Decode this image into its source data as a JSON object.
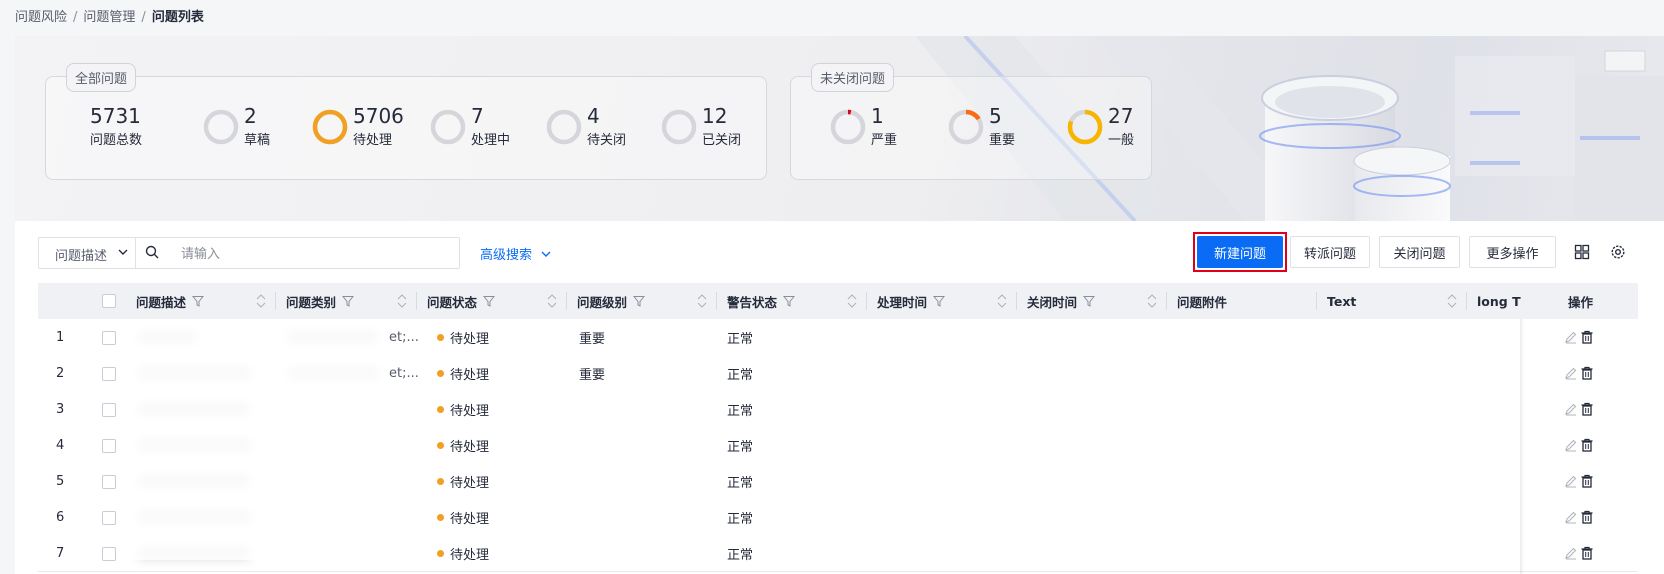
{
  "breadcrumb": {
    "items": [
      "问题风险",
      "问题管理"
    ],
    "current": "问题列表",
    "separator": "/"
  },
  "summary_all": {
    "title": "全部问题",
    "total": {
      "value": "5731",
      "label": "问题总数"
    },
    "stats": [
      {
        "value": "2",
        "label": "草稿",
        "ratio": 0,
        "color": "#d4d6db"
      },
      {
        "value": "5706",
        "label": "待处理",
        "ratio": 1,
        "color": "#f2a024"
      },
      {
        "value": "7",
        "label": "处理中",
        "ratio": 0,
        "color": "#d4d6db"
      },
      {
        "value": "4",
        "label": "待关闭",
        "ratio": 0,
        "color": "#d4d6db"
      },
      {
        "value": "12",
        "label": "已关闭",
        "ratio": 0,
        "color": "#d4d6db"
      }
    ]
  },
  "summary_open": {
    "title": "未关闭问题",
    "stats": [
      {
        "value": "1",
        "label": "严重",
        "ratio": 0.03,
        "color": "#e0001b"
      },
      {
        "value": "5",
        "label": "重要",
        "ratio": 0.16,
        "color": "#fa6b16"
      },
      {
        "value": "27",
        "label": "一般",
        "ratio": 0.81,
        "color": "#f7b500"
      }
    ]
  },
  "toolbar": {
    "search_field": "问题描述",
    "search_placeholder": "请输入",
    "advanced_search": "高级搜索",
    "buttons": {
      "new": "新建问题",
      "transfer": "转派问题",
      "close": "关闭问题",
      "more": "更多操作"
    }
  },
  "table": {
    "headers": {
      "desc": "问题描述",
      "category": "问题类别",
      "status": "问题状态",
      "level": "问题级别",
      "alert": "警告状态",
      "handle_time": "处理时间",
      "close_time": "关闭时间",
      "attachment": "问题附件",
      "text": "Text",
      "long": "long T",
      "ops": "操作"
    },
    "rows": [
      {
        "index": "1",
        "category_tail": "et;...",
        "status": "待处理",
        "level": "重要",
        "alert": "正常"
      },
      {
        "index": "2",
        "category_tail": "et;...",
        "status": "待处理",
        "level": "重要",
        "alert": "正常"
      },
      {
        "index": "3",
        "category_tail": "",
        "status": "待处理",
        "level": "",
        "alert": "正常"
      },
      {
        "index": "4",
        "category_tail": "",
        "status": "待处理",
        "level": "",
        "alert": "正常"
      },
      {
        "index": "5",
        "category_tail": "",
        "status": "待处理",
        "level": "",
        "alert": "正常"
      },
      {
        "index": "6",
        "category_tail": "",
        "status": "待处理",
        "level": "",
        "alert": "正常"
      },
      {
        "index": "7",
        "category_tail": "",
        "status": "待处理",
        "level": "",
        "alert": "正常"
      }
    ]
  },
  "colors": {
    "primary": "#0a6cf5",
    "pending_dot": "#f2a024",
    "highlight": "#e0001b"
  }
}
